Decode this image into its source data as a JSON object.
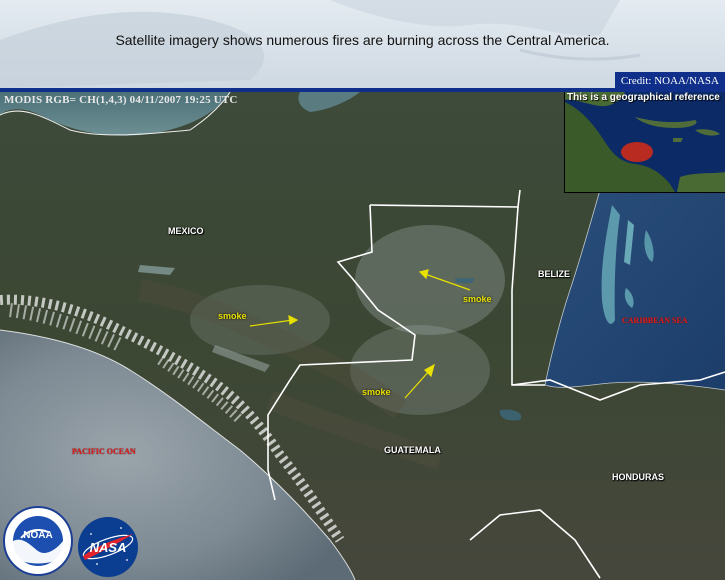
{
  "header": {
    "text": "Satellite imagery shows numerous fires are burning across the Central America.",
    "credit": "Credit: NOAA/NASA"
  },
  "map": {
    "modis_caption": "MODIS RGB= CH(1,4,3) 04/11/2007 19:25 UTC",
    "countries": {
      "mexico": "MEXICO",
      "belize": "BELIZE",
      "guatemala": "GUATEMALA",
      "honduras": "HONDURAS"
    },
    "smoke_labels": [
      "smoke",
      "smoke",
      "smoke"
    ],
    "oceans": {
      "pacific": "PACIFIC OCEAN",
      "caribbean": "CARIBBEAN SEA"
    },
    "colors": {
      "smoke_label": "#e8e000",
      "ocean_label": "#e02020",
      "border": "#ffffff",
      "banner_blue": "#0f2f8a"
    }
  },
  "inset": {
    "title": "This is a geographical reference"
  },
  "logos": {
    "noaa": {
      "icon": "noaa-logo",
      "text": "NOAA"
    },
    "nasa": {
      "icon": "nasa-logo",
      "text": "NASA"
    }
  }
}
